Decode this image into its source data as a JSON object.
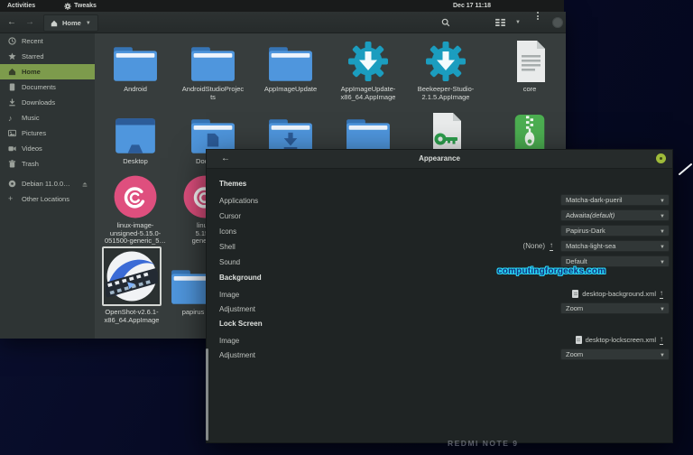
{
  "topbar": {
    "activities_label": "Activities",
    "tweaks_label": "Tweaks",
    "clock": "Dec 17 11:18"
  },
  "file_manager": {
    "path_button_label": "Home",
    "sidebar": {
      "items": [
        {
          "label": "Recent"
        },
        {
          "label": "Starred"
        },
        {
          "label": "Home",
          "active": true
        },
        {
          "label": "Documents"
        },
        {
          "label": "Downloads"
        },
        {
          "label": "Music"
        },
        {
          "label": "Pictures"
        },
        {
          "label": "Videos"
        },
        {
          "label": "Trash"
        },
        {
          "label": "Debian 11.0.0…"
        },
        {
          "label": "Other Locations"
        }
      ]
    },
    "grid": {
      "items": [
        {
          "label": "Android",
          "icon": "folder"
        },
        {
          "label": "AndroidStudioProjec\nts",
          "icon": "folder"
        },
        {
          "label": "AppImageUpdate",
          "icon": "folder"
        },
        {
          "label": "AppImageUpdate-\nx86_64.AppImage",
          "icon": "appimage"
        },
        {
          "label": "Beekeeper-Studio-\n2.1.5.AppImage",
          "icon": "appimage"
        },
        {
          "label": "core",
          "icon": "text-file"
        },
        {
          "label": "Desktop",
          "icon": "folder-desktop"
        },
        {
          "label": "Documents",
          "icon": "folder-documents"
        },
        {
          "label": "",
          "icon": "folder-download"
        },
        {
          "label": "",
          "icon": "folder"
        },
        {
          "label": "",
          "icon": "key-file"
        },
        {
          "label": "",
          "icon": "zip-archive"
        },
        {
          "label": "linux-image-\nunsigned-5.15.0-\n051500-generic_5…",
          "icon": "deb-package"
        },
        {
          "label": "linux-\n5.15.0\ngeneric_",
          "icon": "deb-package"
        },
        {
          "label": "OpenShot-v2.6.1-\nx86_64.AppImage",
          "icon": "openshot",
          "selected": true
        },
        {
          "label": "papirus",
          "icon": "folder"
        }
      ]
    }
  },
  "tweaks_dialog": {
    "title": "Appearance",
    "themes": {
      "header": "Themes",
      "rows": [
        {
          "label": "Applications",
          "value": "Matcha-dark-pueril"
        },
        {
          "label": "Cursor",
          "value": "Adwaita ",
          "value_suffix": "(default)"
        },
        {
          "label": "Icons",
          "value": "Papirus-Dark"
        },
        {
          "label": "Shell",
          "prefix": "(None)",
          "value": "Matcha-light-sea"
        },
        {
          "label": "Sound",
          "value": "Default"
        }
      ]
    },
    "background": {
      "header": "Background",
      "image_label": "Image",
      "image_file": "desktop-background.xml",
      "adjustment_label": "Adjustment",
      "adjustment_value": "Zoom"
    },
    "lock_screen": {
      "header": "Lock Screen",
      "image_label": "Image",
      "image_file": "desktop-lockscreen.xml",
      "adjustment_label": "Adjustment",
      "adjustment_value": "Zoom"
    }
  },
  "watermark": "computingforgeeks.com",
  "device_watermark": "REDMI NOTE 9",
  "colors": {
    "accent_green": "#7d9b4c",
    "folder_blue": "#4f96dd",
    "appimage_teal": "#1b9dbf",
    "deb_pink": "#df4f7e",
    "archive_green": "#4cae51",
    "close_button_green": "#9fbb3a",
    "watermark_cyan": "#28d3f2"
  }
}
